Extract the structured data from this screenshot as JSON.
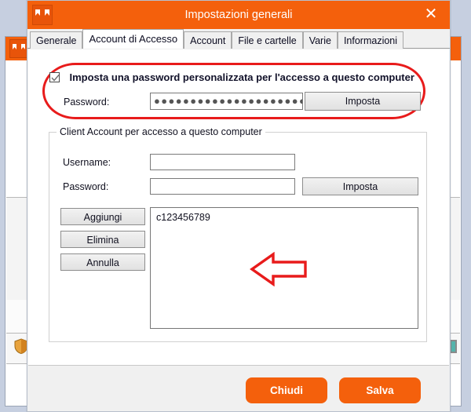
{
  "background_window": {
    "app_icon": "app-logo-icon",
    "close_label": "✕",
    "shield_icon": "shield-icon",
    "status_square_1": "teal-square-icon",
    "status_square_2": "teal-square-icon"
  },
  "dialog": {
    "title": "Impostazioni generali",
    "app_icon": "app-logo-icon",
    "close_label": "✕",
    "tabs": [
      {
        "label": "Generale",
        "active": false
      },
      {
        "label": "Account di Accesso",
        "active": true
      },
      {
        "label": "Account",
        "active": false
      },
      {
        "label": "File e cartelle",
        "active": false
      },
      {
        "label": "Varie",
        "active": false
      },
      {
        "label": "Informazioni",
        "active": false
      }
    ],
    "custom_password": {
      "checkbox_checked": true,
      "checkbox_label": "Imposta una password personalizzata per l'accesso a questo computer",
      "password_label": "Password:",
      "password_value": "●●●●●●●●●●●●●●●●●●●●●●●●●●●",
      "password_placeholder": "",
      "set_button_label": "Imposta"
    },
    "client_account_group": {
      "legend": "Client Account per accesso a questo computer",
      "username_label": "Username:",
      "username_value": "",
      "username_placeholder": "",
      "password_label": "Password:",
      "password_value": "",
      "password_placeholder": "",
      "set_button_label": "Imposta",
      "add_button_label": "Aggiungi",
      "delete_button_label": "Elimina",
      "cancel_button_label": "Annulla",
      "account_list": [
        "c123456789"
      ]
    },
    "footer": {
      "close_button_label": "Chiudi",
      "save_button_label": "Salva"
    }
  },
  "annotations": {
    "highlight_ellipse": "red-ellipse-highlight",
    "pointer_arrow": "red-arrow-annotation"
  },
  "colors": {
    "brand_orange": "#f4600c",
    "annotation_red": "#e81b1b",
    "desktop_blue": "#c6cfe0",
    "teal": "#54b3ab"
  }
}
